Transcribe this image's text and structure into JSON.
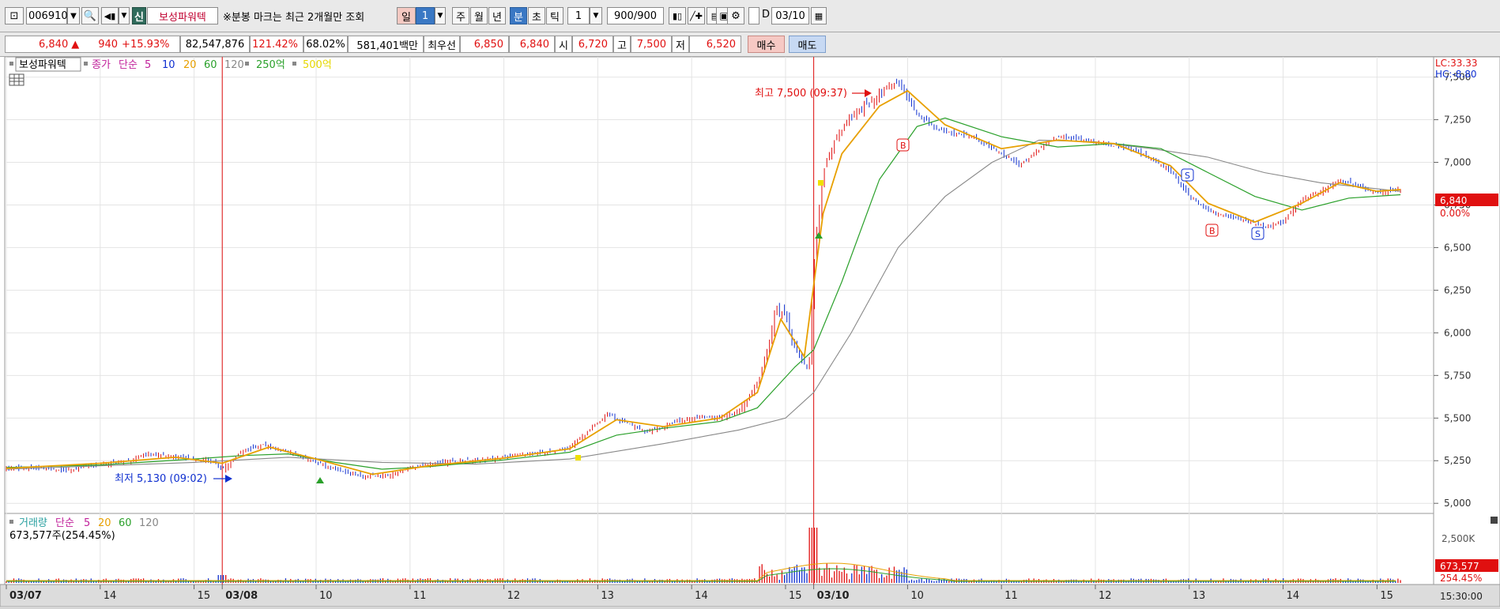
{
  "toolbar": {
    "code": "006910",
    "shin_badge": "신",
    "stock_name": "보성파워텍",
    "notice": "※분봉 마크는 최근 2개월만 조회",
    "period_day": "일",
    "period_day_num": "1",
    "period_week": "주",
    "period_month": "월",
    "period_year": "년",
    "period_minute": "분",
    "period_second": "초",
    "period_tick": "틱",
    "interval": "1",
    "count": "900",
    "count_total": "/900",
    "d_label": "D",
    "date": "03/10"
  },
  "quote": {
    "price": "6,840",
    "arrow": "▲",
    "change": "940",
    "change_pct": "+15.93%",
    "volume": "82,547,876",
    "vol_ratio": "121.42%",
    "turnover": "68.02%",
    "amount": "581,401백만",
    "best_bid_label": "최우선",
    "best_ask": "6,850",
    "best_bid": "6,840",
    "open_label": "시",
    "open": "6,720",
    "high_label": "고",
    "high": "7,500",
    "low_label": "저",
    "low": "6,520",
    "buy_label": "매수",
    "sell_label": "매도"
  },
  "legend": {
    "name": "보성파워텍",
    "close_label": "종가",
    "ma_type": "단순",
    "ma": [
      "5",
      "10",
      "20",
      "60",
      "120"
    ],
    "extra1": "250억",
    "extra2": "500억",
    "vol_label": "거래량",
    "vol_ma_type": "단순",
    "vol_ma": [
      "5",
      "20",
      "60",
      "120"
    ],
    "vol_value": "673,577주(254.45%)"
  },
  "annotations": {
    "high": "최고 7,500 (09:37)",
    "low": "최저 5,130 (09:02)"
  },
  "right_labels": {
    "lc": "LC:33.33",
    "hc": "HC:-8.80",
    "price_badge": "6,840",
    "price_pct": "0.00%",
    "vol_badge": "673,577",
    "vol_pct": "254.45%",
    "vol_tick": "2,500K"
  },
  "bottom": {
    "time": "15:30:00"
  },
  "colors": {
    "up": "#e01010",
    "down": "#1030d0",
    "ma5": "#e8a000",
    "ma20": "#2aa02a",
    "ma60": "#888888",
    "accent": "#3a78c4"
  },
  "chart_data": {
    "type": "candlestick",
    "price_axis": {
      "ticks": [
        5000,
        5250,
        5500,
        5750,
        6000,
        6250,
        6500,
        6750,
        7000,
        7250,
        7500
      ],
      "labels": [
        "5,000",
        "5,250",
        "5,500",
        "5,750",
        "6,000",
        "6,250",
        "6,500",
        "6,750",
        "7,000",
        "7,250",
        "7,500"
      ],
      "range": [
        4950,
        7600
      ]
    },
    "time_axis": [
      {
        "label": "03/07",
        "day": true,
        "t": 0
      },
      {
        "label": "14",
        "t": 1.0
      },
      {
        "label": "15",
        "t": 2.0
      },
      {
        "label": "03/08",
        "day": true,
        "t": 2.3
      },
      {
        "label": "10",
        "t": 3.3
      },
      {
        "label": "11",
        "t": 4.3
      },
      {
        "label": "12",
        "t": 5.3
      },
      {
        "label": "13",
        "t": 6.3
      },
      {
        "label": "14",
        "t": 7.3
      },
      {
        "label": "15",
        "t": 8.3
      },
      {
        "label": "03/10",
        "day": true,
        "t": 8.6
      },
      {
        "label": "10",
        "t": 9.6
      },
      {
        "label": "11",
        "t": 10.6
      },
      {
        "label": "12",
        "t": 11.6
      },
      {
        "label": "13",
        "t": 12.6
      },
      {
        "label": "14",
        "t": 13.6
      },
      {
        "label": "15",
        "t": 14.6
      }
    ],
    "day_separators": [
      2.3,
      8.6
    ],
    "t_range": [
      0,
      14.9
    ],
    "close_path": [
      [
        0.0,
        5200
      ],
      [
        0.3,
        5210
      ],
      [
        0.6,
        5190
      ],
      [
        1.0,
        5230
      ],
      [
        1.3,
        5250
      ],
      [
        1.5,
        5290
      ],
      [
        1.8,
        5270
      ],
      [
        2.0,
        5260
      ],
      [
        2.2,
        5250
      ],
      [
        2.3,
        5200
      ],
      [
        2.5,
        5300
      ],
      [
        2.7,
        5340
      ],
      [
        2.9,
        5320
      ],
      [
        3.1,
        5280
      ],
      [
        3.3,
        5240
      ],
      [
        3.5,
        5200
      ],
      [
        3.8,
        5160
      ],
      [
        4.1,
        5170
      ],
      [
        4.3,
        5210
      ],
      [
        4.6,
        5240
      ],
      [
        4.9,
        5250
      ],
      [
        5.2,
        5260
      ],
      [
        5.5,
        5290
      ],
      [
        5.8,
        5300
      ],
      [
        6.0,
        5330
      ],
      [
        6.2,
        5420
      ],
      [
        6.4,
        5520
      ],
      [
        6.6,
        5470
      ],
      [
        6.8,
        5420
      ],
      [
        7.0,
        5450
      ],
      [
        7.2,
        5490
      ],
      [
        7.4,
        5510
      ],
      [
        7.6,
        5500
      ],
      [
        7.8,
        5540
      ],
      [
        8.0,
        5700
      ],
      [
        8.1,
        5900
      ],
      [
        8.2,
        6150
      ],
      [
        8.3,
        6100
      ],
      [
        8.4,
        5900
      ],
      [
        8.55,
        5800
      ],
      [
        8.6,
        6400
      ],
      [
        8.7,
        6950
      ],
      [
        8.8,
        7100
      ],
      [
        9.0,
        7280
      ],
      [
        9.2,
        7350
      ],
      [
        9.4,
        7450
      ],
      [
        9.5,
        7470
      ],
      [
        9.7,
        7280
      ],
      [
        9.9,
        7200
      ],
      [
        10.1,
        7170
      ],
      [
        10.3,
        7150
      ],
      [
        10.6,
        7050
      ],
      [
        10.8,
        6980
      ],
      [
        11.0,
        7080
      ],
      [
        11.2,
        7150
      ],
      [
        11.5,
        7130
      ],
      [
        11.8,
        7100
      ],
      [
        12.1,
        7050
      ],
      [
        12.4,
        6950
      ],
      [
        12.6,
        6800
      ],
      [
        12.8,
        6720
      ],
      [
        13.0,
        6680
      ],
      [
        13.2,
        6660
      ],
      [
        13.4,
        6620
      ],
      [
        13.6,
        6650
      ],
      [
        13.8,
        6780
      ],
      [
        14.0,
        6830
      ],
      [
        14.2,
        6900
      ],
      [
        14.4,
        6860
      ],
      [
        14.6,
        6820
      ],
      [
        14.8,
        6840
      ]
    ],
    "ma5_path": [
      [
        0.0,
        5205
      ],
      [
        1.0,
        5235
      ],
      [
        1.8,
        5270
      ],
      [
        2.3,
        5235
      ],
      [
        2.8,
        5330
      ],
      [
        3.3,
        5260
      ],
      [
        3.9,
        5170
      ],
      [
        4.5,
        5220
      ],
      [
        5.3,
        5265
      ],
      [
        6.0,
        5320
      ],
      [
        6.5,
        5490
      ],
      [
        7.0,
        5450
      ],
      [
        7.6,
        5500
      ],
      [
        8.0,
        5650
      ],
      [
        8.25,
        6080
      ],
      [
        8.5,
        5860
      ],
      [
        8.7,
        6700
      ],
      [
        8.9,
        7050
      ],
      [
        9.3,
        7330
      ],
      [
        9.6,
        7420
      ],
      [
        10.0,
        7220
      ],
      [
        10.6,
        7080
      ],
      [
        11.2,
        7130
      ],
      [
        11.8,
        7110
      ],
      [
        12.4,
        6980
      ],
      [
        12.8,
        6760
      ],
      [
        13.3,
        6650
      ],
      [
        13.8,
        6760
      ],
      [
        14.2,
        6880
      ],
      [
        14.6,
        6830
      ],
      [
        14.85,
        6840
      ]
    ],
    "ma20_path": [
      [
        0.0,
        5210
      ],
      [
        1.0,
        5225
      ],
      [
        2.0,
        5260
      ],
      [
        2.5,
        5280
      ],
      [
        3.0,
        5290
      ],
      [
        3.5,
        5240
      ],
      [
        4.0,
        5200
      ],
      [
        4.5,
        5215
      ],
      [
        5.3,
        5255
      ],
      [
        6.0,
        5300
      ],
      [
        6.5,
        5400
      ],
      [
        7.0,
        5440
      ],
      [
        7.6,
        5480
      ],
      [
        8.0,
        5560
      ],
      [
        8.4,
        5800
      ],
      [
        8.6,
        5900
      ],
      [
        8.9,
        6300
      ],
      [
        9.3,
        6900
      ],
      [
        9.7,
        7210
      ],
      [
        10.0,
        7260
      ],
      [
        10.6,
        7150
      ],
      [
        11.2,
        7090
      ],
      [
        11.8,
        7110
      ],
      [
        12.3,
        7080
      ],
      [
        12.8,
        6940
      ],
      [
        13.3,
        6800
      ],
      [
        13.8,
        6720
      ],
      [
        14.3,
        6790
      ],
      [
        14.85,
        6810
      ]
    ],
    "ma60_path": [
      [
        0.0,
        5200
      ],
      [
        1.0,
        5220
      ],
      [
        2.0,
        5240
      ],
      [
        3.0,
        5270
      ],
      [
        4.0,
        5240
      ],
      [
        5.0,
        5230
      ],
      [
        6.0,
        5260
      ],
      [
        7.0,
        5350
      ],
      [
        7.8,
        5430
      ],
      [
        8.3,
        5500
      ],
      [
        8.6,
        5650
      ],
      [
        9.0,
        6000
      ],
      [
        9.5,
        6500
      ],
      [
        10.0,
        6800
      ],
      [
        10.5,
        7000
      ],
      [
        11.0,
        7130
      ],
      [
        11.6,
        7120
      ],
      [
        12.2,
        7080
      ],
      [
        12.8,
        7030
      ],
      [
        13.4,
        6940
      ],
      [
        14.0,
        6880
      ],
      [
        14.85,
        6830
      ]
    ],
    "ma5_color": "#e8a000",
    "ma20_color": "#2aa02a",
    "ma60_color": "#888888"
  }
}
